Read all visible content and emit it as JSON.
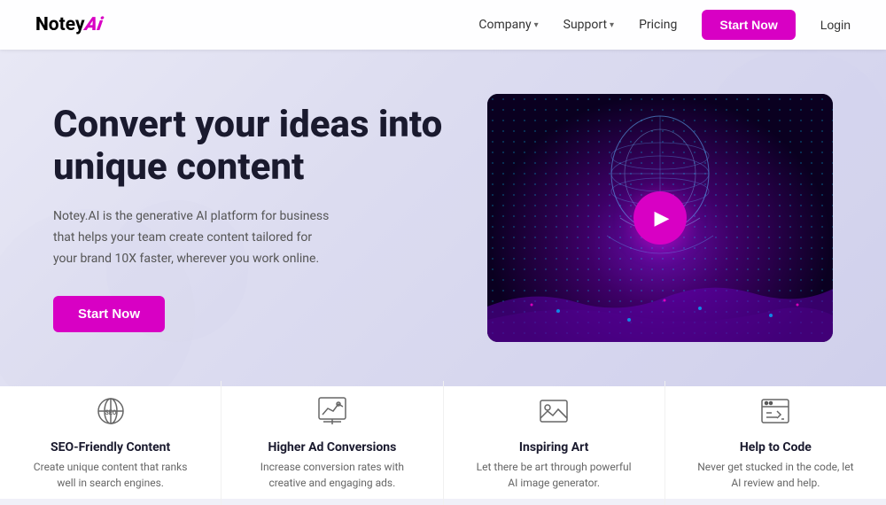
{
  "nav": {
    "logo_text": "Notey",
    "logo_ai": "Ai",
    "links": [
      {
        "label": "Company",
        "has_dropdown": true
      },
      {
        "label": "Support",
        "has_dropdown": true
      },
      {
        "label": "Pricing",
        "has_dropdown": false
      }
    ],
    "btn_start": "Start Now",
    "btn_login": "Login"
  },
  "hero": {
    "title_line1": "Convert your ideas into",
    "title_line2": "unique content",
    "description": "Notey.AI is the generative AI platform for business that helps your team create content tailored for your brand 10X faster, wherever you work online.",
    "btn_label": "Start Now"
  },
  "features": [
    {
      "icon": "seo",
      "title": "SEO-Friendly Content",
      "description": "Create unique content that ranks well in search engines."
    },
    {
      "icon": "chart",
      "title": "Higher Ad Conversions",
      "description": "Increase conversion rates with creative and engaging ads."
    },
    {
      "icon": "image",
      "title": "Inspiring Art",
      "description": "Let there be art through powerful AI image generator."
    },
    {
      "icon": "code",
      "title": "Help to Code",
      "description": "Never get stucked in the code, let AI review and help."
    }
  ]
}
